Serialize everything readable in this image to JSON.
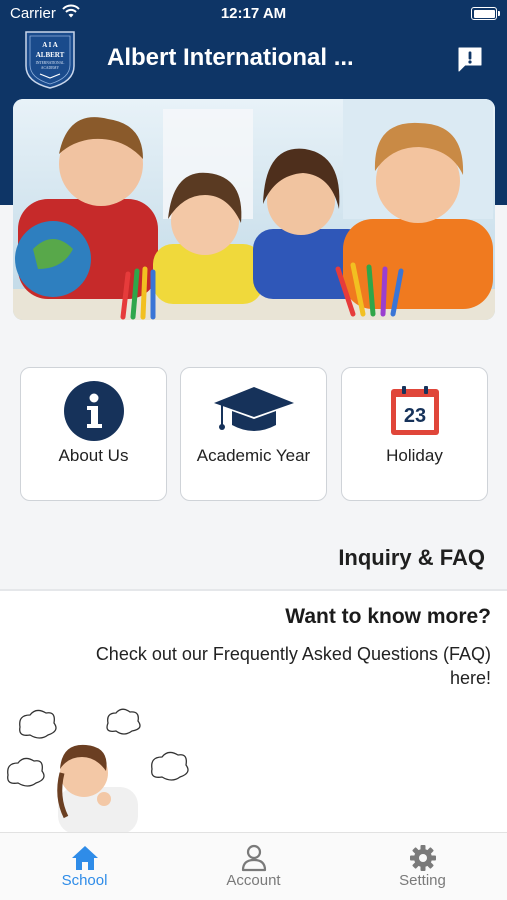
{
  "status_bar": {
    "carrier": "Carrier",
    "time": "12:17 AM"
  },
  "header": {
    "title": "Albert International ...",
    "logo_text": {
      "top": "A I A",
      "name": "ALBERT",
      "sub": "INTERNATIONAL ACADEMY"
    },
    "alert_icon": "alert-message-icon"
  },
  "home_cards": [
    {
      "label": "About Us",
      "icon": "info-icon"
    },
    {
      "label": "Academic Year",
      "icon": "graduation-cap-icon"
    },
    {
      "label": "Holiday",
      "icon": "calendar-icon",
      "calendar_day": "23"
    }
  ],
  "inquiry": {
    "section_title": "Inquiry & FAQ",
    "heading": "Want to know more?",
    "text": "Check out our Frequently Asked Questions (FAQ) here!"
  },
  "tab_bar": {
    "items": [
      {
        "label": "School",
        "icon": "home-icon",
        "active": true
      },
      {
        "label": "Account",
        "icon": "person-icon",
        "active": false
      },
      {
        "label": "Setting",
        "icon": "gear-icon",
        "active": false
      }
    ]
  },
  "colors": {
    "header": "#0e3566",
    "accent": "#2f8ce8",
    "icon_dark": "#16325a",
    "calendar_red": "#e0463a"
  }
}
